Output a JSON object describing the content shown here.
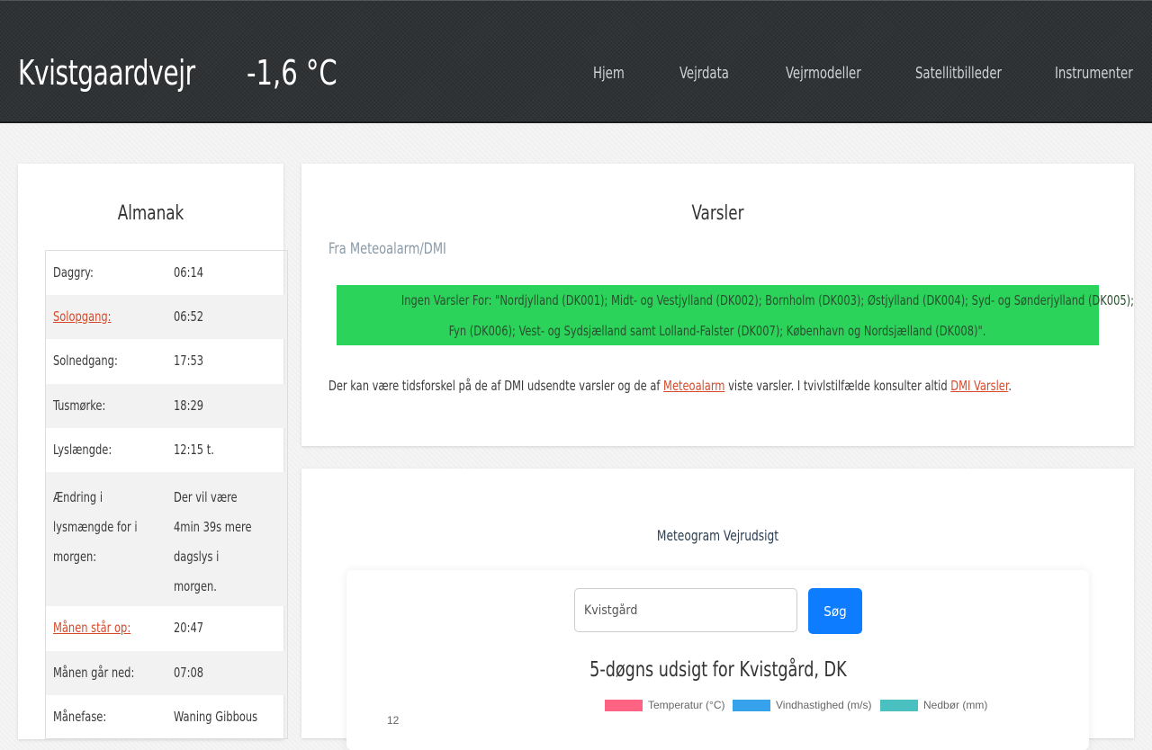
{
  "header": {
    "site_title": "Kvistgaardvejr",
    "temperature": "-1,6 °C",
    "nav": [
      {
        "label": "Hjem"
      },
      {
        "label": "Vejrdata"
      },
      {
        "label": "Vejrmodeller"
      },
      {
        "label": "Satellitbilleder"
      },
      {
        "label": "Instrumenter"
      }
    ]
  },
  "almanac": {
    "title": "Almanak",
    "rows": [
      {
        "label": "Daggry:",
        "value": "06:14",
        "link": false
      },
      {
        "label": "Solopgang:",
        "value": "06:52",
        "link": true
      },
      {
        "label": "Solnedgang:",
        "value": "17:53",
        "link": false
      },
      {
        "label": "Tusmørke:",
        "value": "18:29",
        "link": false
      },
      {
        "label": "Lyslængde:",
        "value": "12:15 t.",
        "link": false
      },
      {
        "label": "Ændring i lysmængde for i morgen:",
        "value": "Der vil være 4min 39s mere dagslys i morgen.",
        "link": false
      },
      {
        "label": "Månen står op:",
        "value": "20:47",
        "link": true
      },
      {
        "label": "Månen går ned:",
        "value": "07:08",
        "link": false
      },
      {
        "label": "Månefase:",
        "value": "Waning Gibbous",
        "link": false
      }
    ]
  },
  "warnings": {
    "title": "Varsler",
    "source": "Fra Meteoalarm/DMI",
    "alert_line1": "Ingen Varsler For: \"Nordjylland (DK001); Midt- og Vestjylland (DK002); Bornholm (DK003); Østjylland (DK004); Syd- og Sønderjylland (DK005);",
    "alert_line2": "Fyn (DK006); Vest- og Sydsjælland samt Lolland-Falster (DK007); København og Nordsjælland (DK008)\".",
    "alert_color": "#2bd35a",
    "note_prefix": "Der kan være tidsforskel på de af DMI udsendte varsler og de af ",
    "note_link1": "Meteoalarm",
    "note_middle": " viste varsler. I tvivlstilfælde konsulter altid ",
    "note_link2": "DMI Varsler",
    "note_suffix": "."
  },
  "meteogram": {
    "title": "Meteogram Vejrudsigt",
    "search_value": "Kvistgård",
    "search_button": "Søg",
    "forecast_title": "5-døgns udsigt for Kvistgård, DK"
  },
  "chart_data": {
    "type": "line",
    "title": "5-døgns udsigt for Kvistgård, DK",
    "legend_placement": "top",
    "series": [
      {
        "name": "Temperatur (°C)",
        "color": "#ff6384",
        "values": []
      },
      {
        "name": "Vindhastighed (m/s)",
        "color": "#36a2eb",
        "values": []
      },
      {
        "name": "Nedbør (mm)",
        "color": "#4bc0c0",
        "values": []
      }
    ],
    "y_ticks": [
      "12"
    ]
  },
  "colors": {
    "accent_link": "#d64a2b",
    "header_bg": "#2f3234",
    "button_blue": "#0d7cff"
  }
}
